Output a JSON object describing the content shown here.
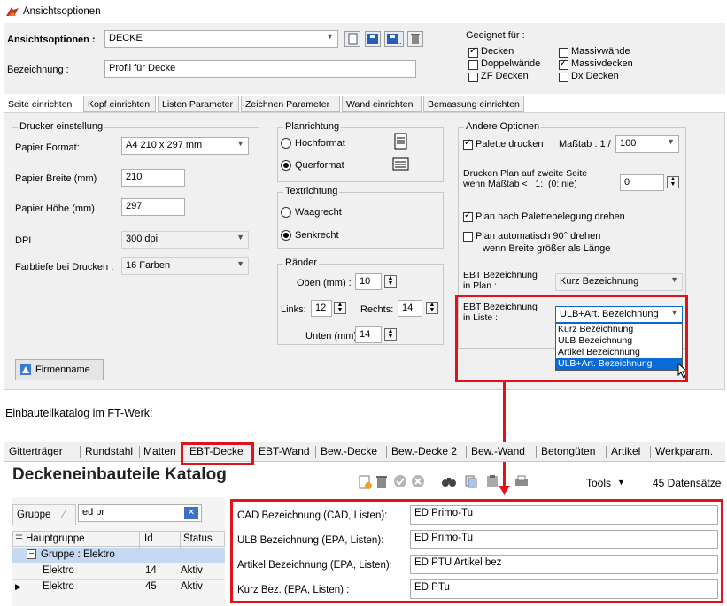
{
  "window": {
    "title": "Ansichtsoptionen"
  },
  "header": {
    "options_label": "Ansichtsoptionen :",
    "options_value": "DECKE",
    "bezeichnung_label": "Bezeichnung :",
    "bezeichnung_value": "Profil für Decke",
    "geeignet_label": "Geeignet für :",
    "geeignet": [
      {
        "label": "Decken",
        "checked": true
      },
      {
        "label": "Massivwände",
        "checked": false
      },
      {
        "label": "Doppelwände",
        "checked": false
      },
      {
        "label": "Massivdecken",
        "checked": true
      },
      {
        "label": "ZF Decken",
        "checked": false
      },
      {
        "label": "Dx Decken",
        "checked": false
      }
    ]
  },
  "tabs": [
    "Seite einrichten",
    "Kopf einrichten",
    "Listen Parameter",
    "Zeichnen Parameter",
    "Wand einrichten",
    "Bemassung einrichten"
  ],
  "drucker": {
    "title": "Drucker einstellung",
    "papier_format_label": "Papier Format:",
    "papier_format_value": "A4 210 x 297 mm",
    "breite_label": "Papier Breite (mm)",
    "breite_value": "210",
    "hoehe_label": "Papier Höhe (mm)",
    "hoehe_value": "297",
    "dpi_label": "DPI",
    "dpi_value": "300 dpi",
    "farbtiefe_label": "Farbtiefe bei Drucken :",
    "farbtiefe_value": "16 Farben",
    "firmenname_button": "Firmenname"
  },
  "planrichtung": {
    "title": "Planrichtung",
    "hoch": "Hochformat",
    "quer": "Querformat"
  },
  "textrichtung": {
    "title": "Textrichtung",
    "waag": "Waagrecht",
    "senk": "Senkrecht"
  },
  "raender": {
    "title": "Ränder",
    "oben_label": "Oben (mm) :",
    "oben_value": "10",
    "links_label": "Links:",
    "links_value": "12",
    "rechts_label": "Rechts:",
    "rechts_value": "14",
    "unten_label": "Unten (mm)",
    "unten_value": "14"
  },
  "andere": {
    "title": "Andere Optionen",
    "palette_label": "Palette drucken",
    "massstab_label": "Maßtab : 1 /",
    "massstab_value": "100",
    "zweite_seite_line1": "Drucken Plan auf zweite Seite",
    "zweite_seite_line2": "wenn Maßtab <   1:  (0: nie)",
    "zweite_seite_value": "0",
    "palettebelegung_label": "Plan nach Palettebelegung drehen",
    "auto90_line1": "Plan automatisch 90° drehen",
    "auto90_line2": "wenn Breite größer als Länge",
    "ebt_plan_line1": "EBT Bezeichnung",
    "ebt_plan_line2": "in Plan :",
    "ebt_plan_value": "Kurz Bezeichnung",
    "ebt_liste_line1": "EBT Bezeichnung",
    "ebt_liste_line2": "in Liste :",
    "ebt_liste_value": "ULB+Art. Bezeichnung",
    "ebt_liste_options": [
      "Kurz Bezeichnung",
      "ULB Bezeichnung",
      "Artikel Bezeichnung",
      "ULB+Art. Bezeichnung"
    ]
  },
  "caption": "Einbauteilkatalog im FT-Werk:",
  "ft": {
    "tabs": [
      "Gitterträger",
      "Rundstahl",
      "Matten",
      "EBT-Decke",
      "EBT-Wand",
      "Bew.-Decke",
      "Bew.-Decke 2",
      "Bew.-Wand",
      "Betongüten",
      "Artikel",
      "Werkparam."
    ],
    "catalog_title": "Deckeneinbauteile Katalog",
    "tools_label": "Tools",
    "count_label": "45 Datensätze",
    "gruppe_label": "Gruppe",
    "search_value": "ed pr",
    "columns": [
      "Hauptgruppe",
      "Id",
      "Status"
    ],
    "group_row": "Gruppe : Elektro",
    "rows": [
      {
        "hauptgruppe": "Elektro",
        "id": "14",
        "status": "Aktiv"
      },
      {
        "hauptgruppe": "Elektro",
        "id": "45",
        "status": "Aktiv"
      }
    ],
    "details": [
      {
        "label": "CAD Bezeichnung (CAD, Listen):",
        "value": "ED Primo-Tu"
      },
      {
        "label": "ULB Bezeichnung (EPA, Listen):",
        "value": "ED Primo-Tu"
      },
      {
        "label": "Artikel Bezeichnung (EPA, Listen):",
        "value": "ED PTU Artikel bez"
      },
      {
        "label": "Kurz Bez. (EPA, Listen) :",
        "value": "ED PTu"
      }
    ]
  }
}
